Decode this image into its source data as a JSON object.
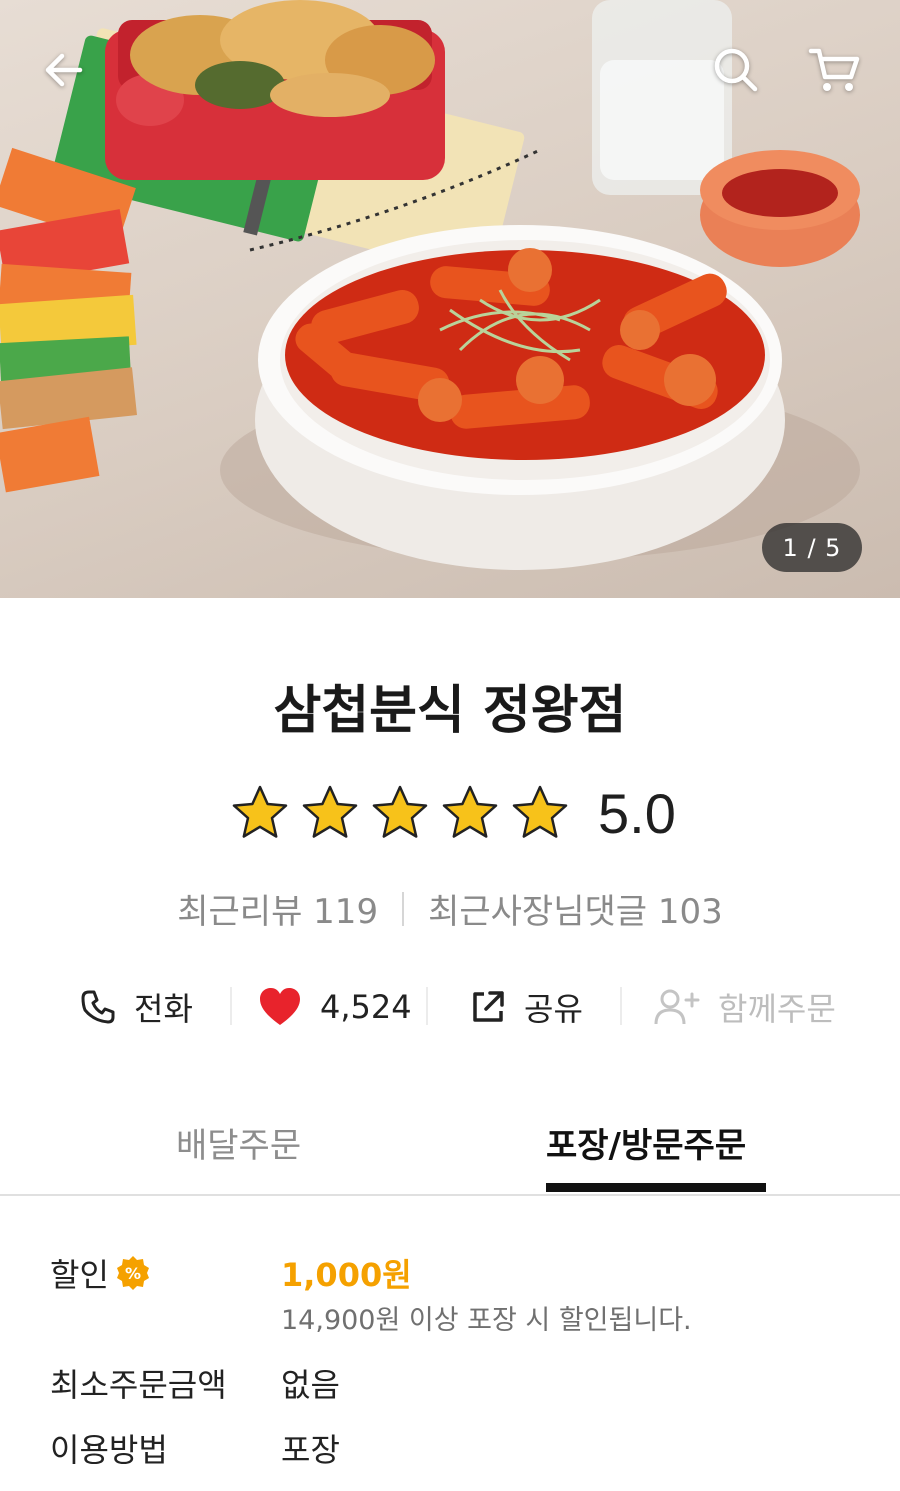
{
  "hero": {
    "image_counter": "1 / 5",
    "back_icon": "arrow-left-icon",
    "search_icon": "search-icon",
    "cart_icon": "cart-icon"
  },
  "store": {
    "name": "삼첩분식 정왕점",
    "rating": 5.0,
    "rating_text": "5.0",
    "stars_filled": 5,
    "star_color": "#f7c21a",
    "recent_reviews": "최근리뷰 119",
    "recent_owner_replies": "최근사장님댓글 103"
  },
  "actions": {
    "call_label": "전화",
    "like_count": "4,524",
    "share_label": "공유",
    "group_order_label": "함께주문",
    "heart_color": "#e8232c"
  },
  "tabs": {
    "delivery_label": "배달주문",
    "pickup_label": "포장/방문주문",
    "active": "pickup"
  },
  "info": {
    "discount_label": "할인",
    "discount_badge": "%",
    "discount_amount": "1,000원",
    "discount_note": "14,900원 이상 포장 시 할인됩니다.",
    "min_order_label": "최소주문금액",
    "min_order_value": "없음",
    "method_label": "이용방법",
    "method_value": "포장",
    "accent_color": "#f5a100"
  }
}
